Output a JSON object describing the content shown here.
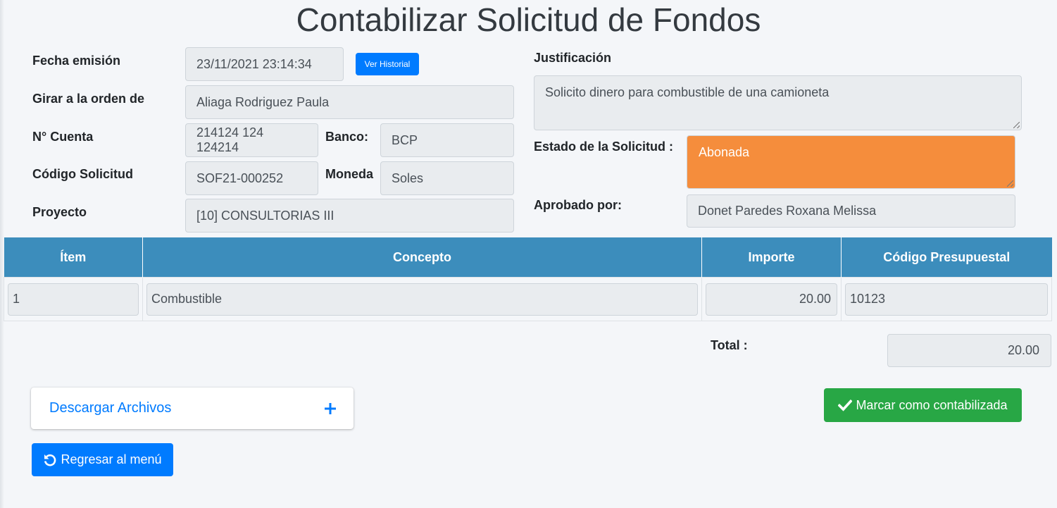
{
  "page": {
    "title": "Contabilizar Solicitud de Fondos"
  },
  "form": {
    "fecha_label": "Fecha emisión",
    "fecha_value": "23/11/2021 23:14:34",
    "ver_historial_label": "Ver Historial",
    "girar_label": "Girar a la orden de",
    "girar_value": "Aliaga Rodriguez Paula",
    "cuenta_label": "N° Cuenta",
    "cuenta_value": "214124 124 124214",
    "banco_label": "Banco:",
    "banco_value": "BCP",
    "codigo_label": "Código Solicitud",
    "codigo_value": "SOF21-000252",
    "moneda_label": "Moneda",
    "moneda_value": "Soles",
    "proyecto_label": "Proyecto",
    "proyecto_value": "[10] CONSULTORIAS III",
    "justificacion_label": "Justificación",
    "justificacion_value": "Solicito dinero para combustible de una camioneta",
    "estado_label": "Estado de la Solicitud :",
    "estado_value": "Abonada",
    "aprobado_label": "Aprobado por:",
    "aprobado_value": "Donet Paredes Roxana Melissa"
  },
  "table": {
    "headers": [
      "Ítem",
      "Concepto",
      "Importe",
      "Código Presupuestal"
    ],
    "rows": [
      {
        "item": "1",
        "concepto": "Combustible",
        "importe": "20.00",
        "codigo": "10123"
      }
    ]
  },
  "totals": {
    "label": "Total :",
    "value": "20.00"
  },
  "files": {
    "label": "Descargar Archivos",
    "icon": "plus-icon"
  },
  "actions": {
    "mark_label": "Marcar como contabilizada",
    "mark_icon": "check-icon",
    "back_label": "Regresar al menú",
    "back_icon": "undo-icon"
  },
  "colors": {
    "primary": "#007bff",
    "success": "#28a745",
    "table_header": "#3c8dbc",
    "estado_bg": "#f58d3c",
    "field_bg": "#e9ecef",
    "page_bg": "#f4f6f9"
  }
}
